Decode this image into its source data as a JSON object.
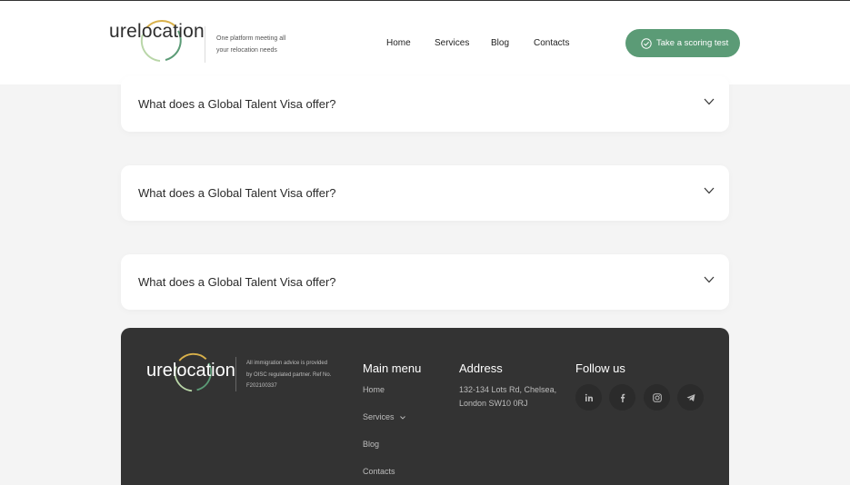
{
  "header": {
    "logo_text": "urelocation",
    "tagline": "One platform meeting all your relocation needs",
    "nav": [
      "Home",
      "Services",
      "Blog",
      "Contacts"
    ],
    "cta_label": "Take a scoring test"
  },
  "faq": [
    {
      "question": "What does a Global Talent Visa offer?"
    },
    {
      "question": "What does a Global Talent Visa offer?"
    },
    {
      "question": "What does a Global Talent Visa offer?"
    }
  ],
  "footer": {
    "logo_text": "urelocation",
    "note": "All immigration advice is provided by OISC regulated partner. Ref No. F202100337",
    "main_menu": {
      "heading": "Main menu",
      "items": [
        "Home",
        "Services",
        "Blog",
        "Contacts"
      ]
    },
    "address": {
      "heading": "Address",
      "text": "132-134 Lots Rd, Chelsea, London SW10 0RJ"
    },
    "follow": {
      "heading": "Follow us",
      "icons": [
        "linkedin-icon",
        "facebook-icon",
        "instagram-icon",
        "telegram-icon"
      ]
    }
  },
  "colors": {
    "accent_green": "#5b9b76",
    "footer_bg": "#333333",
    "page_bg": "#f4f4f4"
  }
}
